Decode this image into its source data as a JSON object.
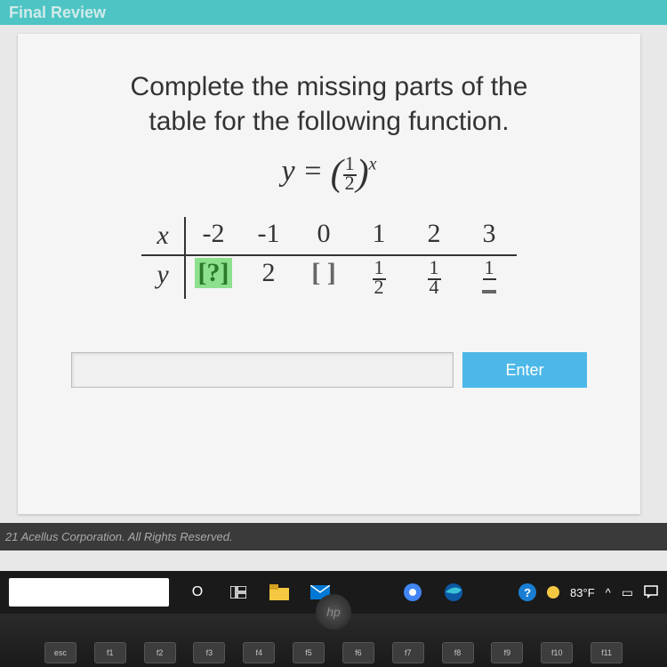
{
  "header": {
    "title": "Final Review"
  },
  "question": {
    "line1": "Complete the missing parts of the",
    "line2": "table for the following function.",
    "equation_y": "y",
    "equation_eq": " = ",
    "frac_num": "1",
    "frac_den": "2",
    "exponent": "x"
  },
  "table": {
    "x_label": "x",
    "y_label": "y",
    "x_values": [
      "-2",
      "-1",
      "0",
      "1",
      "2",
      "3"
    ],
    "y_values": {
      "v0": "[?]",
      "v1": "2",
      "v2": "[ ]",
      "v3_num": "1",
      "v3_den": "2",
      "v4_num": "1",
      "v4_den": "4",
      "v5_num": "1",
      "v5_den_box": " "
    }
  },
  "input": {
    "value": "",
    "enter_label": "Enter"
  },
  "footer": {
    "copyright": "21 Acellus Corporation. All Rights Reserved."
  },
  "taskbar": {
    "cortana": "O",
    "taskview": "⊞",
    "help": "?",
    "weather_temp": "83°F",
    "caret": "^"
  }
}
